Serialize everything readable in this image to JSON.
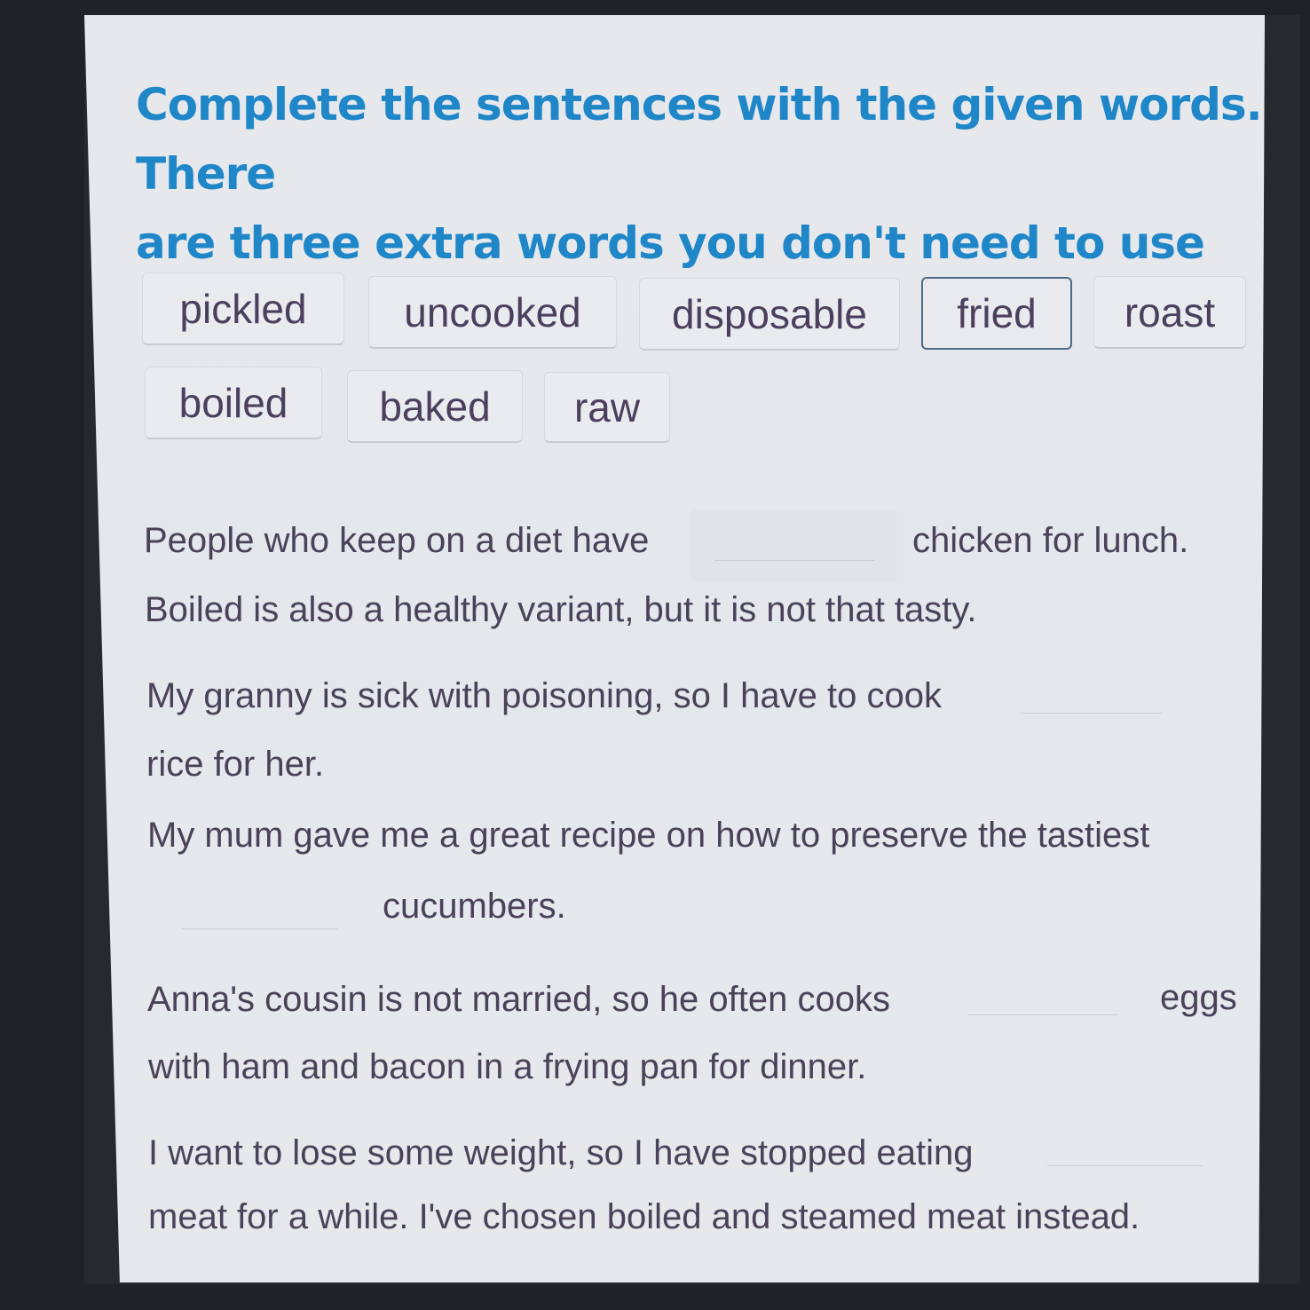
{
  "instruction": {
    "line1": "Complete the sentences with the given words. There",
    "line2": "are three extra words you don't need to use"
  },
  "word_bank": {
    "words": [
      "pickled",
      "uncooked",
      "disposable",
      "fried",
      "roast",
      "boiled",
      "baked",
      "raw"
    ],
    "selected": "fried"
  },
  "sentences": [
    {
      "before": "People who keep on a diet have",
      "after": "chicken for lunch.",
      "continuation": "Boiled is also a healthy variant, but it is not that tasty.",
      "answer": ""
    },
    {
      "before": "My granny is sick with poisoning, so I have to cook",
      "after": "rice for her.",
      "answer": ""
    },
    {
      "before": "My mum gave me a great recipe on how to preserve the tastiest",
      "after": "cucumbers.",
      "answer": ""
    },
    {
      "before": "Anna's cousin is not married, so he often cooks",
      "after": "eggs",
      "continuation": "with ham and bacon in a frying pan for dinner.",
      "answer": ""
    },
    {
      "before": "I want to lose some weight, so I have stopped eating",
      "after": "meat for a while. I've chosen boiled and steamed meat instead.",
      "answer": ""
    }
  ]
}
